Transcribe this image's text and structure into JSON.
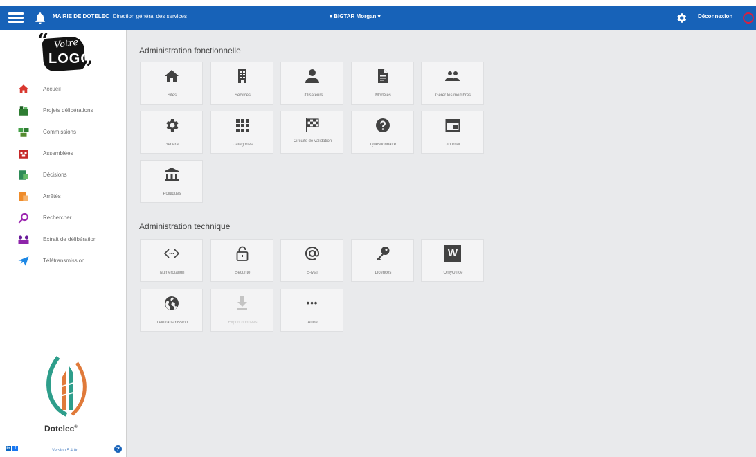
{
  "topbar": {
    "org": "MAIRIE DE DOTELEC",
    "service": "Direction général des services",
    "user": "▾ BIGTAR Morgan ▾",
    "logout": "Déconnexion"
  },
  "sidebar": {
    "logo_top": "Votre",
    "logo_main": "LOGO",
    "items": [
      {
        "label": "Accueil",
        "icon": "home-icon",
        "color": "#d9382f"
      },
      {
        "label": "Projets délibérations",
        "icon": "projects-icon",
        "color": "#2e7d32"
      },
      {
        "label": "Commissions",
        "icon": "commissions-icon",
        "color": "#43a047"
      },
      {
        "label": "Assemblées",
        "icon": "assemblies-icon",
        "color": "#c62828"
      },
      {
        "label": "Décisions",
        "icon": "decisions-icon",
        "color": "#2e8b57"
      },
      {
        "label": "Arrêtés",
        "icon": "orders-icon",
        "color": "#ef8c2b"
      },
      {
        "label": "Rechercher",
        "icon": "search-icon",
        "color": "#9c27b0"
      },
      {
        "label": "Extrait de délibération",
        "icon": "extract-icon",
        "color": "#6a1b9a"
      },
      {
        "label": "Télétransmission",
        "icon": "teletransmission-icon",
        "color": "#1e88e5"
      }
    ],
    "brand": "Dotelec",
    "brand_mark": "®",
    "footer": {
      "linkedin": "in",
      "facebook": "f",
      "version": "Version 5.4.0c",
      "help": "?"
    }
  },
  "main": {
    "section1": {
      "title": "Administration fonctionnelle",
      "tiles": [
        {
          "label": "Sites",
          "icon": "home-icon"
        },
        {
          "label": "Services",
          "icon": "building-icon"
        },
        {
          "label": "Utilisateurs",
          "icon": "user-icon"
        },
        {
          "label": "Modèles",
          "icon": "document-icon"
        },
        {
          "label": "Gérer les membres",
          "icon": "group-icon"
        },
        {
          "label": "Général",
          "icon": "gear-icon"
        },
        {
          "label": "Catégories",
          "icon": "grid-icon"
        },
        {
          "label": "Circuits de validation",
          "icon": "checkered-flag-icon"
        },
        {
          "label": "Questionnaire",
          "icon": "question-icon"
        },
        {
          "label": "Journal",
          "icon": "journal-icon"
        },
        {
          "label": "Politiques",
          "icon": "institution-icon"
        }
      ]
    },
    "section2": {
      "title": "Administration technique",
      "tiles": [
        {
          "label": "Numérotation",
          "icon": "code-icon"
        },
        {
          "label": "Sécurité",
          "icon": "lock-icon"
        },
        {
          "label": "E-Mail",
          "icon": "at-icon"
        },
        {
          "label": "Licences",
          "icon": "key-icon"
        },
        {
          "label": "OnlyOffice",
          "icon": "word-icon",
          "glyph": "W"
        },
        {
          "label": "Télétransmission",
          "icon": "globe-icon"
        },
        {
          "label": "Export données",
          "icon": "download-icon",
          "disabled": true
        },
        {
          "label": "Autre",
          "icon": "more-icon",
          "glyph": "•••"
        }
      ]
    }
  }
}
